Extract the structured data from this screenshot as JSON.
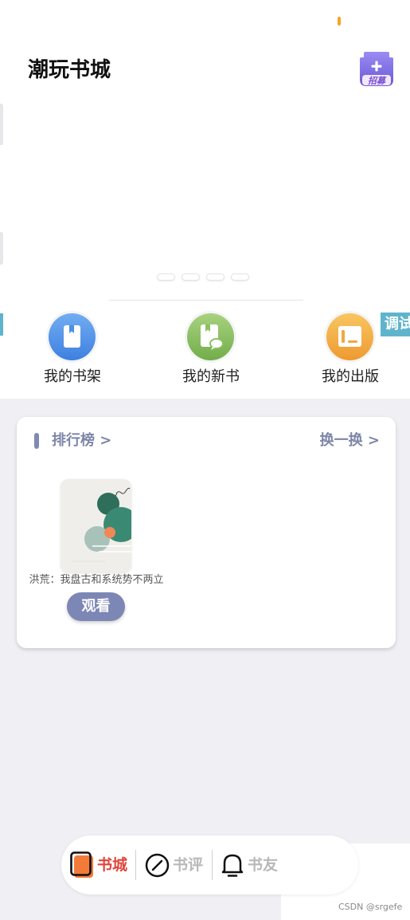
{
  "app": {
    "title": "潮玩书城",
    "recruit_label": "招募",
    "recruit_icon": "recruit-house-plus-icon",
    "debug_badge": "调试"
  },
  "carousel": {
    "dot_count": 4
  },
  "shortcuts": [
    {
      "label": "我的书架",
      "icon": "bookshelf-icon",
      "color": "#4a8fe6"
    },
    {
      "label": "我的新书",
      "icon": "new-book-icon",
      "color": "#8cc063"
    },
    {
      "label": "我的出版",
      "icon": "publish-icon",
      "color": "#f2a83e"
    }
  ],
  "ranking": {
    "title": "排行榜 >",
    "refresh": "换一换 >",
    "books": [
      {
        "title": "洪荒：我盘古和系统势不两立",
        "action": "观看"
      }
    ]
  },
  "tabbar": [
    {
      "label": "书城",
      "icon": "book-icon",
      "active": true
    },
    {
      "label": "书评",
      "icon": "compass-icon",
      "active": false
    },
    {
      "label": "书友",
      "icon": "bell-icon",
      "active": false
    }
  ],
  "watermark": "CSDN @srgefe",
  "colors": {
    "page_bg": "#efeff4",
    "accent_active_tab": "#e0443a",
    "inactive_tab": "#b8b8b8",
    "ranking_text": "#7d86a8",
    "watch_button": "#7c87b6",
    "debug_badge": "#5fb4cc"
  }
}
